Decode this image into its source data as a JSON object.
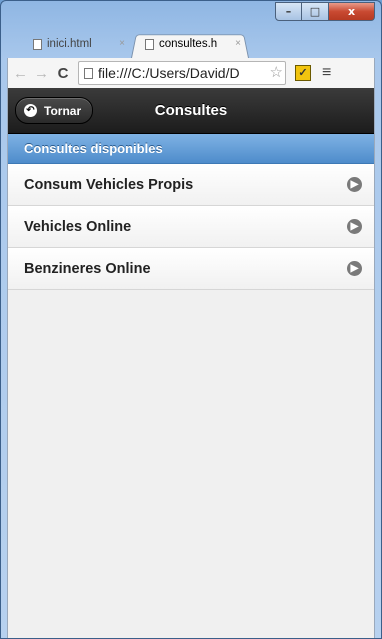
{
  "browser": {
    "tabs": [
      {
        "title": "inici.html",
        "close": "×"
      },
      {
        "title": "consultes.h",
        "close": "×"
      }
    ],
    "window_buttons": {
      "minimize": "–",
      "maximize": "□",
      "close": "x"
    },
    "toolbar": {
      "back_icon": "←",
      "forward_icon": "→",
      "reload_icon": "C",
      "url": "file:///C:/Users/David/D",
      "star_icon": "☆",
      "menu_icon": "≡"
    }
  },
  "app": {
    "header": {
      "back_label": "Tornar",
      "title": "Consultes"
    },
    "divider": "Consultes disponibles",
    "items": [
      {
        "label": "Consum Vehicles Propis"
      },
      {
        "label": "Vehicles Online"
      },
      {
        "label": "Benzineres Online"
      }
    ]
  },
  "colors": {
    "header": "#1c1c1c",
    "divider": "#5a96d2",
    "background": "#f0f0f0"
  }
}
